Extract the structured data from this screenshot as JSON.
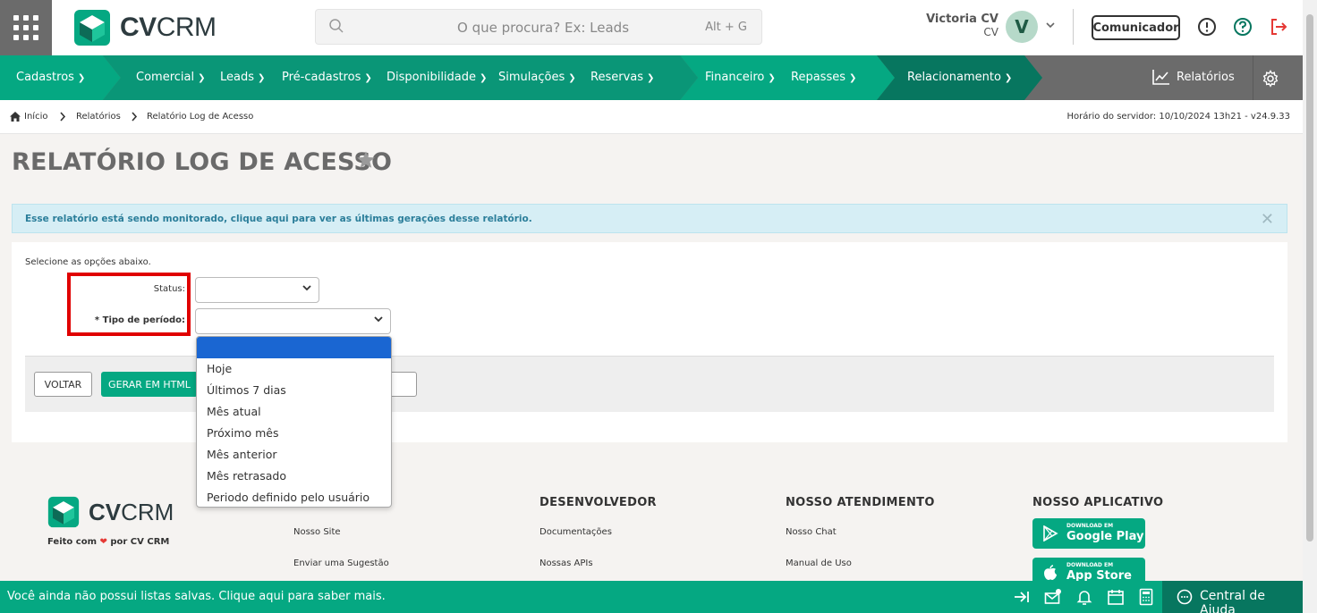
{
  "header": {
    "logo": {
      "prefix": "CV",
      "suffix": "CRM"
    },
    "search": {
      "placeholder": "O que procura? Ex: Leads",
      "shortcut": "Alt + G"
    },
    "user": {
      "name": "Victoria CV",
      "sub": "CV",
      "initial": "V"
    },
    "communicator_label": "Comunicador"
  },
  "nav": {
    "items": [
      "Cadastros",
      "Comercial",
      "Leads",
      "Pré-cadastros",
      "Disponibilidade",
      "Simulações",
      "Reservas",
      "Financeiro",
      "Repasses",
      "Relacionamento"
    ],
    "reports": "Relatórios"
  },
  "breadcrumb": {
    "home": "Início",
    "level1": "Relatórios",
    "current": "Relatório Log de Acesso"
  },
  "server_time": "Horário do servidor: 10/10/2024 13h21 - v24.9.33",
  "page_title": "RELATÓRIO LOG DE ACESSO",
  "alert": "Esse relatório está sendo monitorado, clique aqui para ver as últimas gerações desse relatório.",
  "form": {
    "hint": "Selecione as opções abaixo.",
    "status_label": "Status:",
    "period_label": "* Tipo de período:",
    "period_options": [
      "",
      "Hoje",
      "Últimos 7 dias",
      "Mês atual",
      "Próximo mês",
      "Mês anterior",
      "Mês retrasado",
      "Periodo definido pelo usuário"
    ]
  },
  "buttons": {
    "back": "VOLTAR",
    "html": "GERAR EM HTML"
  },
  "footer": {
    "logo": {
      "prefix": "CV",
      "suffix": "CRM"
    },
    "tagline_before": "Feito com",
    "tagline_after": "por CV CRM",
    "col1": {
      "links": [
        "Nosso Site",
        "Enviar uma Sugestão"
      ]
    },
    "col2": {
      "title": "DESENVOLVEDOR",
      "links": [
        "Documentações",
        "Nossas APIs"
      ]
    },
    "col3": {
      "title": "NOSSO ATENDIMENTO",
      "links": [
        "Nosso Chat",
        "Manual de Uso"
      ]
    },
    "col4": {
      "title": "NOSSO APLICATIVO"
    },
    "google": {
      "small": "DOWNLOAD EM",
      "big": "Google Play"
    },
    "apple": {
      "small": "DOWNLOAD EM",
      "big": "App Store"
    }
  },
  "bottom_bar": {
    "message": "Você ainda não possui listas salvas. Clique aqui para saber mais.",
    "help": "Central de Ajuda"
  },
  "colors": {
    "primary": "#05a882",
    "dark_green": "#07765f",
    "mid_green": "#0a9677",
    "gray": "#6b6b6b",
    "highlight": "#e00000",
    "selected_option": "#1a66d2"
  }
}
